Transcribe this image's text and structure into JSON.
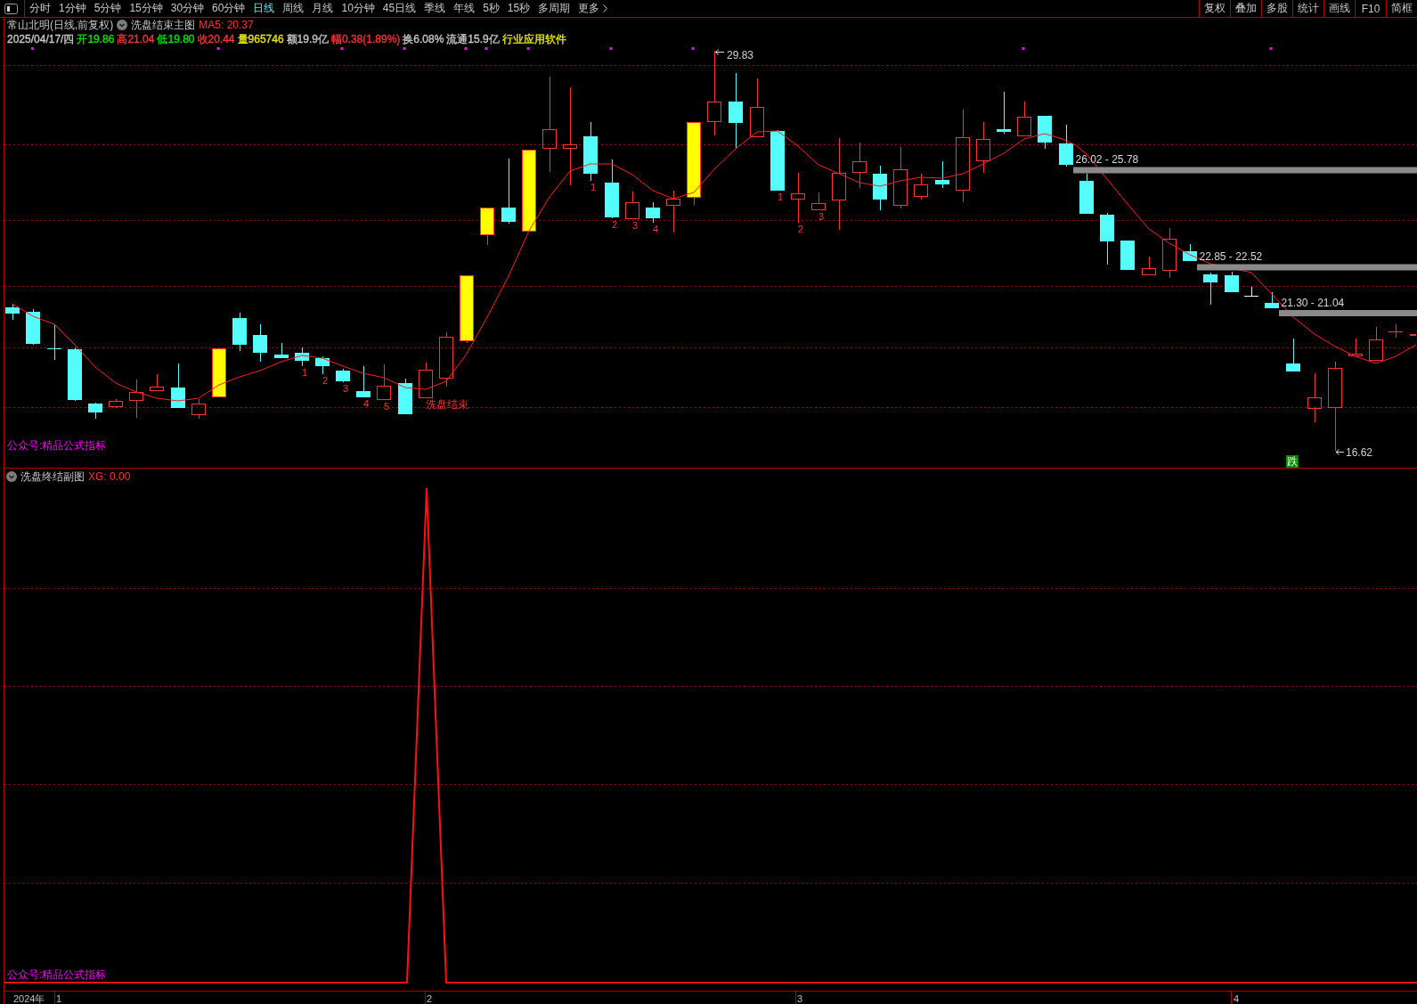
{
  "toolbar": {
    "periods": [
      {
        "label": "分时",
        "selected": false
      },
      {
        "label": "1分钟",
        "selected": false
      },
      {
        "label": "5分钟",
        "selected": false
      },
      {
        "label": "15分钟",
        "selected": false
      },
      {
        "label": "30分钟",
        "selected": false
      },
      {
        "label": "60分钟",
        "selected": false
      },
      {
        "label": "日线",
        "selected": true
      },
      {
        "label": "周线",
        "selected": false
      },
      {
        "label": "月线",
        "selected": false
      },
      {
        "label": "10分钟",
        "selected": false
      },
      {
        "label": "45日线",
        "selected": false
      },
      {
        "label": "季线",
        "selected": false
      },
      {
        "label": "年线",
        "selected": false
      },
      {
        "label": "5秒",
        "selected": false
      },
      {
        "label": "15秒",
        "selected": false
      },
      {
        "label": "多周期",
        "selected": false
      }
    ],
    "more": "更多",
    "actions": [
      "复权",
      "叠加",
      "多股",
      "统计",
      "画线",
      "F10",
      "简框"
    ]
  },
  "main_chart": {
    "title": "常山北明(日线,前复权)",
    "indicator": "洗盘结束主图",
    "ma_reading": "MA5: 20.37",
    "quote": [
      {
        "text": "2025/04/17/四",
        "color": "#c8c8c8"
      },
      {
        "text": "开19.86",
        "color": "#00e600"
      },
      {
        "text": "高21.04",
        "color": "#ff3232"
      },
      {
        "text": "低19.80",
        "color": "#00e600"
      },
      {
        "text": "收20.44",
        "color": "#ff3232"
      },
      {
        "text": "量965746",
        "color": "#e6e600"
      },
      {
        "text": "额19.9亿",
        "color": "#c8c8c8"
      },
      {
        "text": "幅0.38(1.89%)",
        "color": "#ff3232"
      },
      {
        "text": "换6.08%",
        "color": "#c8c8c8"
      },
      {
        "text": "流通15.9亿",
        "color": "#c8c8c8"
      },
      {
        "text": "行业应用软件",
        "color": "#e6e600"
      }
    ],
    "count_marks": [
      "1",
      "2",
      "3",
      "4",
      "5",
      "1",
      "2",
      "3",
      "4",
      "1",
      "2",
      "3"
    ],
    "wash_end_label": "洗盘结束",
    "high_label": "29.83",
    "low_label": "16.62",
    "price_zones": [
      "26.02 - 25.78",
      "22.85 - 22.52",
      "21.30 - 21.04"
    ],
    "fall_signal": "跌",
    "footer_note": "公众号:精品公式指标"
  },
  "sub_chart": {
    "indicator": "洗盘终结副图",
    "reading": "XG: 0.00",
    "footer_note": "公众号:精品公式指标"
  },
  "time_axis": [
    "2024年",
    "1",
    "2",
    "3",
    "4"
  ]
}
